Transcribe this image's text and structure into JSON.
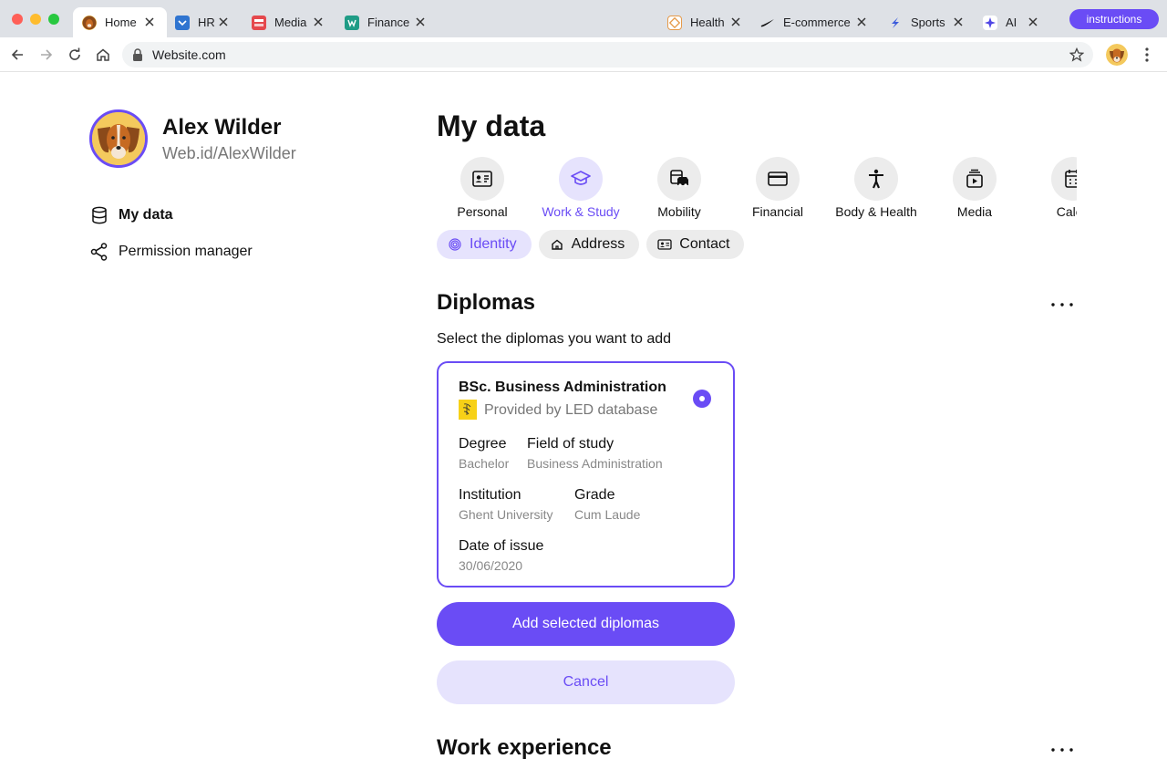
{
  "browser": {
    "tabs": [
      {
        "label": "Home",
        "active": true,
        "icon": "dog-avatar-favicon"
      },
      {
        "label": "HR",
        "active": false,
        "icon": "hr-favicon"
      },
      {
        "label": "Media",
        "active": false,
        "icon": "media-favicon"
      },
      {
        "label": "Finance",
        "active": false,
        "icon": "finance-favicon"
      },
      {
        "label": "Health",
        "active": false,
        "icon": "health-favicon"
      },
      {
        "label": "E-commerce",
        "active": false,
        "icon": "ecommerce-favicon"
      },
      {
        "label": "Sports",
        "active": false,
        "icon": "sports-favicon"
      },
      {
        "label": "AI",
        "active": false,
        "icon": "ai-favicon"
      }
    ],
    "instructions_label": "instructions",
    "url": "Website.com",
    "accent": "#6a4cf5"
  },
  "profile": {
    "name": "Alex Wilder",
    "handle": "Web.id/AlexWilder"
  },
  "sidebar": {
    "items": [
      {
        "label": "My data",
        "icon": "database-icon",
        "active": true
      },
      {
        "label": "Permission manager",
        "icon": "share-icon",
        "active": false
      }
    ]
  },
  "main": {
    "title": "My data",
    "categories": [
      {
        "label": "Personal",
        "icon": "id-card-icon",
        "active": false
      },
      {
        "label": "Work & Study",
        "icon": "graduation-cap-icon",
        "active": true
      },
      {
        "label": "Mobility",
        "icon": "vehicle-icon",
        "active": false
      },
      {
        "label": "Financial",
        "icon": "credit-card-icon",
        "active": false
      },
      {
        "label": "Body & Health",
        "icon": "person-icon",
        "active": false
      },
      {
        "label": "Media",
        "icon": "media-play-icon",
        "active": false
      },
      {
        "label": "Calen",
        "icon": "calendar-icon",
        "active": false
      }
    ],
    "chips": [
      {
        "label": "Identity",
        "icon": "fingerprint-icon",
        "active": true
      },
      {
        "label": "Address",
        "icon": "home-icon",
        "active": false
      },
      {
        "label": "Contact",
        "icon": "contact-card-icon",
        "active": false
      }
    ],
    "diplomas": {
      "title": "Diplomas",
      "subtitle": "Select the diplomas you want to add",
      "card": {
        "title": "BSc. Business Administration",
        "provider": "Provided by LED database",
        "selected": true,
        "fields": {
          "degree": {
            "label": "Degree",
            "value": "Bachelor"
          },
          "field_of_study": {
            "label": "Field of study",
            "value": "Business Administration"
          },
          "institution": {
            "label": "Institution",
            "value": "Ghent University"
          },
          "grade": {
            "label": "Grade",
            "value": "Cum Laude"
          },
          "date_of_issue": {
            "label": "Date of issue",
            "value": "30/06/2020"
          }
        }
      },
      "add_button": "Add selected diplomas",
      "cancel_button": "Cancel"
    },
    "work_experience": {
      "title": "Work experience"
    }
  }
}
